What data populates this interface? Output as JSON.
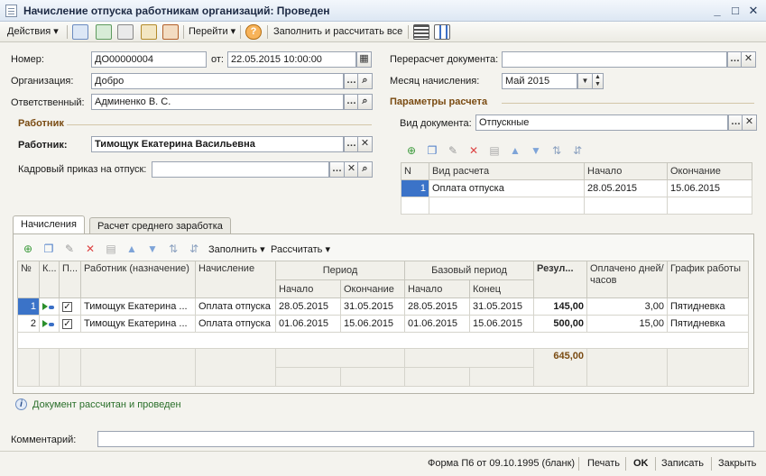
{
  "window": {
    "title": "Начисление отпуска работникам организаций: Проведен",
    "controls": [
      "_",
      "□",
      "✕"
    ]
  },
  "toolbar": {
    "actions_label": "Действия",
    "goto_label": "Перейти",
    "fill_calc_label": "Заполнить и рассчитать все"
  },
  "header": {
    "number_label": "Номер:",
    "number_value": "ДО00000004",
    "from_label": "от:",
    "date_value": "22.05.2015 10:00:00",
    "org_label": "Организация:",
    "org_value": "Добро",
    "responsible_label": "Ответственный:",
    "responsible_value": "Админенко В. С.",
    "recalc_label": "Перерасчет документа:",
    "recalc_value": "",
    "month_label": "Месяц начисления:",
    "month_value": "Май 2015"
  },
  "worker": {
    "section_title": "Работник",
    "worker_label": "Работник:",
    "worker_value": "Тимощук Екатерина Васильевна",
    "order_label": "Кадровый приказ на отпуск:",
    "order_value": ""
  },
  "calc_params": {
    "section_title": "Параметры расчета",
    "doc_type_label": "Вид документа:",
    "doc_type_value": "Отпускные",
    "columns": [
      "N",
      "Вид расчета",
      "Начало",
      "Окончание"
    ],
    "rows": [
      {
        "n": "1",
        "type": "Оплата отпуска",
        "start": "28.05.2015",
        "end": "15.06.2015"
      }
    ]
  },
  "tabs": [
    {
      "label": "Начисления",
      "active": true
    },
    {
      "label": "Расчет среднего заработка",
      "active": false
    }
  ],
  "accruals": {
    "fill_label": "Заполнить",
    "calc_label": "Рассчитать",
    "headers": {
      "n": "№",
      "k": "К...",
      "p": "П...",
      "worker": "Работник (назначение)",
      "accrual": "Начисление",
      "period": "Период",
      "period_start": "Начало",
      "period_end": "Окончание",
      "base_period": "Базовый период",
      "base_start": "Начало",
      "base_end": "Конец",
      "result": "Резул...",
      "paid": "Оплачено дней/часов",
      "schedule": "График работы"
    },
    "rows": [
      {
        "n": "1",
        "worker": "Тимощук Екатерина ...",
        "accrual": "Оплата отпуска",
        "start": "28.05.2015",
        "end": "31.05.2015",
        "base_start": "28.05.2015",
        "base_end": "31.05.2015",
        "result": "145,00",
        "paid": "3,00",
        "schedule": "Пятидневка"
      },
      {
        "n": "2",
        "worker": "Тимощук Екатерина ...",
        "accrual": "Оплата отпуска",
        "start": "01.06.2015",
        "end": "15.06.2015",
        "base_start": "01.06.2015",
        "base_end": "15.06.2015",
        "result": "500,00",
        "paid": "15,00",
        "schedule": "Пятидневка"
      }
    ],
    "total": "645,00"
  },
  "info_text": "Документ рассчитан и проведен",
  "comment_label": "Комментарий:",
  "comment_value": "",
  "footer": {
    "form_label": "Форма П6 от 09.10.1995 (бланк)",
    "print_label": "Печать",
    "ok_label": "OK",
    "save_label": "Записать",
    "close_label": "Закрыть"
  }
}
